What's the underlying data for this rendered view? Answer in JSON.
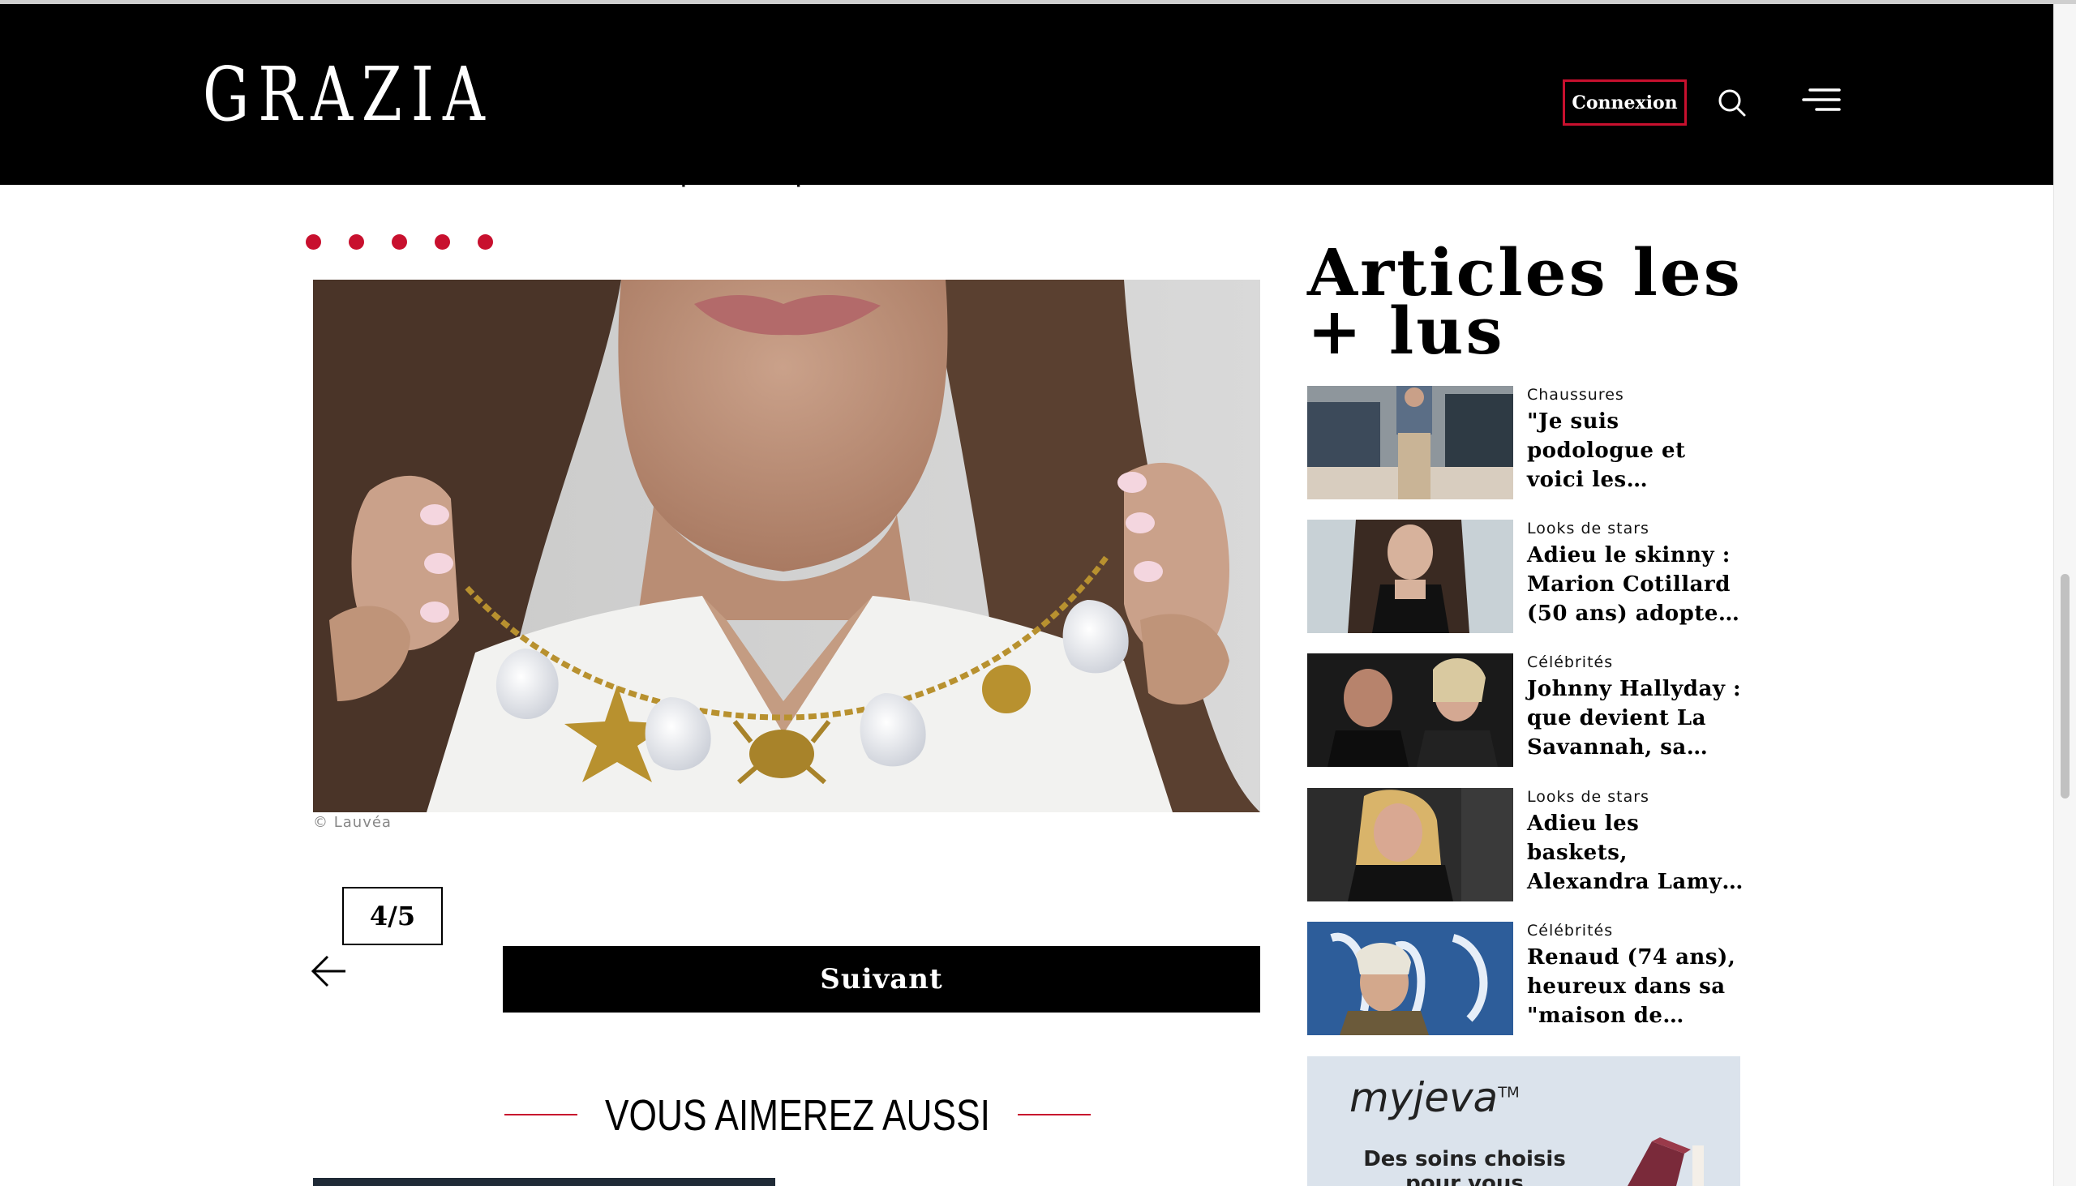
{
  "header": {
    "logo": "GRAZIA",
    "login_label": "Connexion",
    "search_icon": "search-icon",
    "menu_icon": "hamburger-menu-icon"
  },
  "article": {
    "cut_link_text": "printemps",
    "slide_count_dots": 5,
    "image_alt": "Collier coquillages",
    "credit": "© Lauvéa",
    "counter": "4/5",
    "next_label": "Suivant",
    "prev_icon": "arrow-left-icon"
  },
  "also": {
    "title": "VOUS AIMEREZ AUSSI"
  },
  "sidebar": {
    "title": "Articles les + lus",
    "items": [
      {
        "category": "Chaussures",
        "title": "\"Je suis podologue et voici les…"
      },
      {
        "category": "Looks de stars",
        "title": "Adieu le skinny : Marion Cotillard (50 ans) adopte…"
      },
      {
        "category": "Célébrités",
        "title": "Johnny Hallyday : que devient La Savannah, sa…"
      },
      {
        "category": "Looks de stars",
        "title": "Adieu les baskets, Alexandra Lamy…"
      },
      {
        "category": "Célébrités",
        "title": "Renaud (74 ans), heureux dans sa \"maison de…"
      }
    ],
    "ad": {
      "brand": "myjeva",
      "trademark": "TM",
      "text": "Des soins choisis pour vous"
    }
  },
  "colors": {
    "accent": "#c8102e",
    "header_bg": "#000000"
  }
}
